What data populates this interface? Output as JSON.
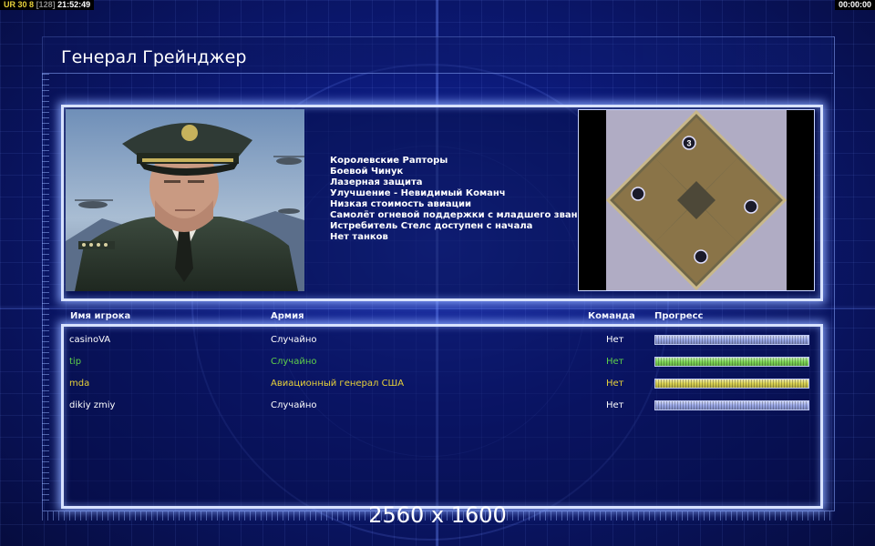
{
  "status": {
    "left_prefix": "UR",
    "left_numbers": "30 8",
    "left_bracket": "[128]",
    "clock": "21:52:49",
    "right_timer": "00:00:00"
  },
  "title": "Генерал Грейнджер",
  "bonuses": [
    "Королевские Рапторы",
    "Боевой Чинук",
    "Лазерная защита",
    "Улучшение - Невидимый Команч",
    "Низкая стоимость авиации",
    "Самолёт огневой поддержки с младшего звания",
    "Истребитель Стелс доступен с начала",
    "Нет танков"
  ],
  "minimap": {
    "start_marker_label": "3"
  },
  "table": {
    "headers": {
      "name": "Имя игрока",
      "army": "Армия",
      "team": "Команда",
      "progress": "Прогресс"
    },
    "rows": [
      {
        "name": "casinoVA",
        "army": "Случайно",
        "team": "Нет",
        "color": "#ffffff",
        "bar_color": "#9aa8e8",
        "progress": 1.0
      },
      {
        "name": "tip",
        "army": "Случайно",
        "team": "Нет",
        "color": "#5fd04a",
        "bar_color": "#7fd858",
        "progress": 1.0
      },
      {
        "name": "mda",
        "army": "Авиационный генерал США",
        "team": "Нет",
        "color": "#e8d23a",
        "bar_color": "#d8d050",
        "progress": 1.0
      },
      {
        "name": "dikiy zmiy",
        "army": "Случайно",
        "team": "Нет",
        "color": "#ffffff",
        "bar_color": "#9aa8e8",
        "progress": 1.0
      }
    ]
  },
  "resolution_label": "2560 x 1600"
}
